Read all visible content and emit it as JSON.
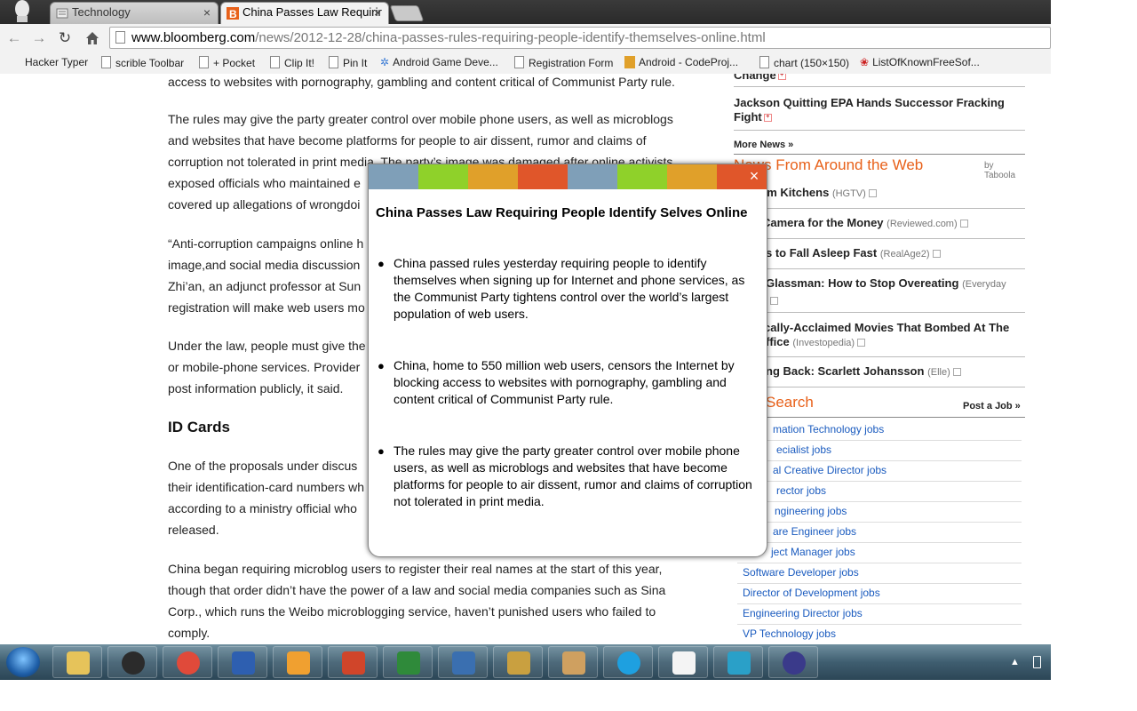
{
  "tabs": [
    {
      "label": "Technology",
      "active": false
    },
    {
      "label": "China Passes Law Requirir",
      "active": true
    }
  ],
  "address": {
    "host": "www.bloomberg.com",
    "path": "/news/2012-12-28/china-passes-rules-requiring-people-identify-themselves-online.html"
  },
  "bookmarks": [
    "Hacker Typer",
    "scrible Toolbar",
    "+ Pocket",
    "Clip It!",
    "Pin It",
    "Android Game Deve...",
    "Registration Form",
    "Android - CodeProj...",
    "chart (150×150)",
    "ListOfKnownFreeSof..."
  ],
  "article": {
    "p0": "access to websites with pornography, gambling and content critical of Communist Party rule.",
    "p1_l1": "The rules may give the party greater control over mobile phone users, as well as microblogs",
    "p1_l2": "and websites that have become platforms for people to air dissent, rumor and claims of",
    "p1_l3": "corruption not tolerated in print media. The party’s image was damaged after online activists",
    "p1_l4": "exposed officials who maintained e",
    "p1_l5": "covered up allegations of wrongdoi",
    "p2_l1": "“Anti-corruption campaigns online h",
    "p2_l2": "image,and social media discussion",
    "p2_l3": "Zhi’an, an adjunct professor at Sun",
    "p2_l4": "registration will make web users mo",
    "p3_l1": "Under the law, people must give the",
    "p3_l2": "or mobile-phone services. Provider",
    "p3_l3": "post information publicly, it said.",
    "heading": "ID Cards",
    "p4_l1": "One of the proposals under discus",
    "p4_l2": "their identification-card numbers wh",
    "p4_l3": "according to a ministry official who",
    "p4_l4": "released.",
    "p5_l1": "China began requiring microblog users to register their real names at the start of this year,",
    "p5_l2": "though that order didn’t have the power of a law and social media companies such as Sina",
    "p5_l3": "Corp., which runs the Weibo microblogging service, haven’t punished users who failed to",
    "p5_l4": "comply."
  },
  "sidebar": {
    "top_item": "Change",
    "story": "Jackson Quitting EPA Hands Successor Fracking",
    "story_l2": "Fight",
    "more_news": "More News »",
    "web_title": "News From Around the Web",
    "by": "by Taboola",
    "web_items": [
      {
        "title": "am Kitchens",
        "src": "(HGTV)"
      },
      {
        "title": "Camera for the Money",
        "src": "(Reviewed.com)"
      },
      {
        "title": "s to Fall Asleep Fast",
        "src": "(RealAge2)"
      },
      {
        "title": "Glassman: How to Stop Overeating",
        "src": "(Everyday"
      },
      {
        "title": "cally-Acclaimed Movies That Bombed At The",
        "src": ""
      },
      {
        "title": "ffice",
        "src": "(Investopedia)"
      },
      {
        "title": "ng Back: Scarlett Johansson",
        "src": "(Elle)"
      }
    ],
    "search_title": "Search",
    "post_job": "Post a Job »",
    "jobs": [
      "mation Technology jobs",
      "ecialist jobs",
      "al Creative Director jobs",
      "rector jobs",
      "ngineering jobs",
      "are Engineer jobs",
      "ject Manager jobs",
      "Software Developer jobs",
      "Director of Development jobs",
      "Engineering Director jobs",
      "VP Technology jobs"
    ]
  },
  "modal": {
    "title": "China Passes Law Requiring People Identify Selves Online",
    "close": "×",
    "bullets": [
      "China passed rules yesterday requiring people to identify themselves when signing up for Internet and phone services, as the Communist Party tightens control over the world’s largest population of web users.",
      "China, home to 550 million web users, censors the Internet by blocking access to websites with pornography, gambling and content critical of Communist Party rule.",
      "The rules may give the party greater control over mobile phone users, as well as microblogs and websites that have become platforms for people to air dissent, rumor and claims of corruption not tolerated in print media."
    ],
    "colors": [
      "#7f9fb8",
      "#8fd12a",
      "#e0a02a",
      "#e0562a",
      "#7f9fb8",
      "#8fd12a",
      "#e0a02a",
      "#e0562a"
    ]
  },
  "taskbar": {
    "apps": [
      "file-explorer-icon",
      "hp-icon",
      "chrome-icon",
      "word-icon",
      "media-player-icon",
      "powerpoint-icon",
      "excel-icon",
      "publisher-icon",
      "sublime-icon",
      "paint-icon",
      "skype-icon",
      "calendar-icon",
      "screenshot-icon",
      "eclipse-icon"
    ]
  },
  "colors": {
    "accent_orange": "#e8611a",
    "link_blue": "#1a5bbf"
  }
}
